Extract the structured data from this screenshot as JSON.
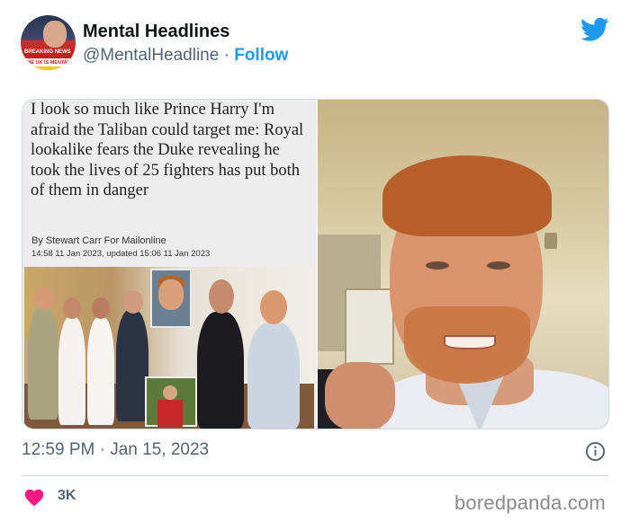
{
  "tweet": {
    "display_name": "Mental Headlines",
    "handle": "@MentalHeadline",
    "separator": "·",
    "follow_label": "Follow",
    "timestamp": "12:59 PM · Jan 15, 2023",
    "like_count": "3K"
  },
  "avatar": {
    "banner_text": "BREAKING NEWS",
    "caption_text": "THE UK IS MENTAL"
  },
  "article": {
    "headline": "I look so much like Prince Harry I'm afraid the Taliban could target me: Royal lookalike fears the Duke revealing he took the lives of 25 fighters has put both of them in danger",
    "byline": "By Stewart Carr For Mailonline",
    "dateline": "14:58 11 Jan 2023, updated 15:06 11 Jan 2023"
  },
  "watermark": "boredpanda.com",
  "colors": {
    "brand_blue": "#1d9bf0",
    "like_pink": "#f91880",
    "muted_text": "#536471"
  },
  "icons": {
    "brand": "twitter-bird-icon",
    "info": "info-icon",
    "like": "heart-icon"
  }
}
